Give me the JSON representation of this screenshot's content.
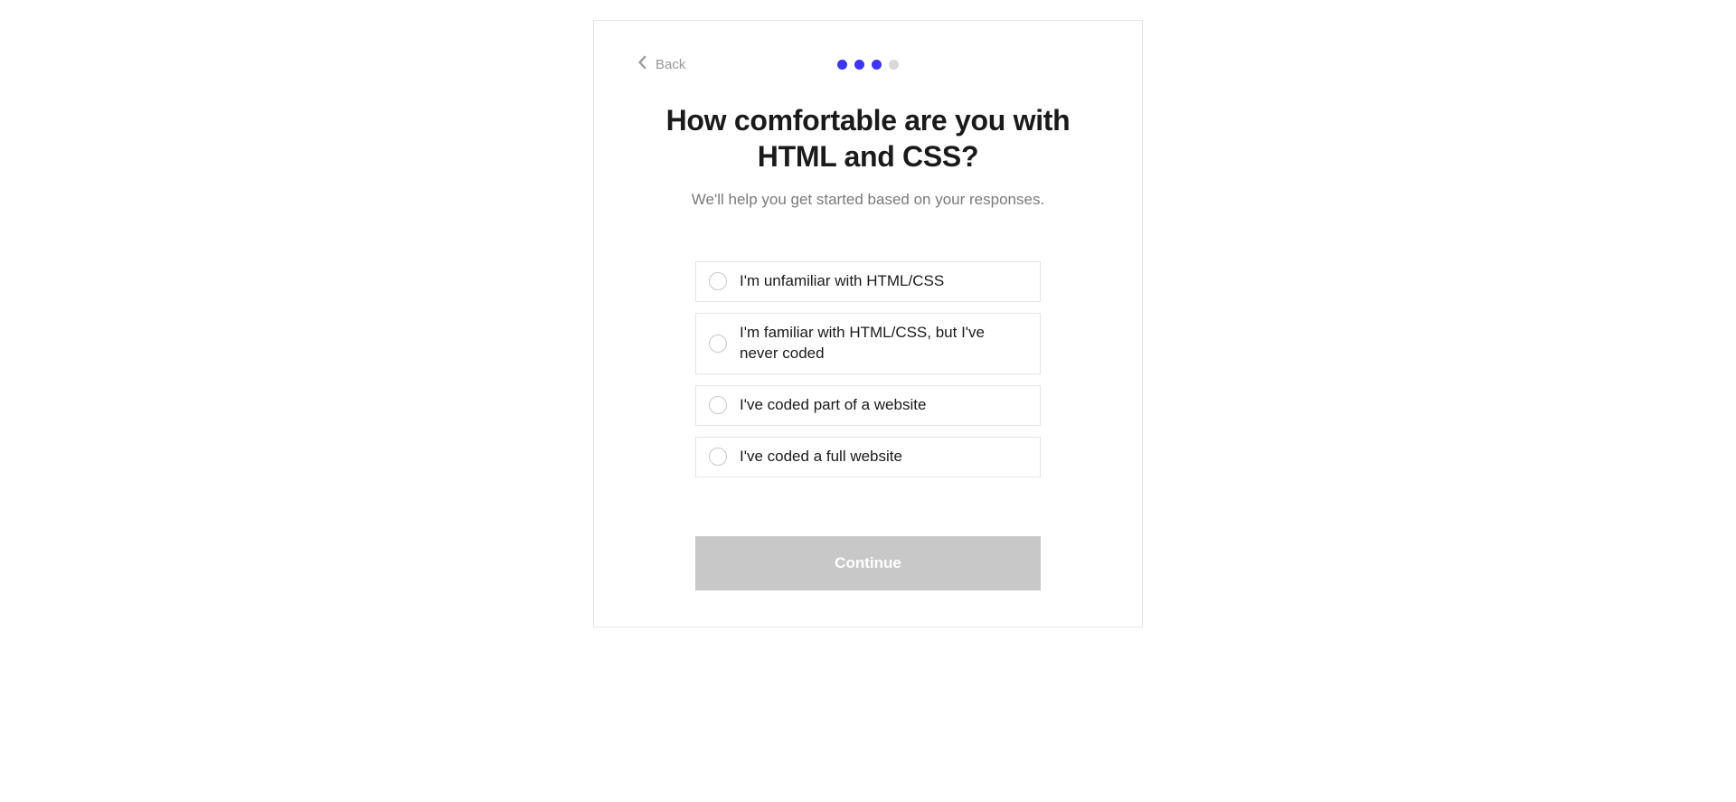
{
  "back": {
    "label": "Back"
  },
  "progress": {
    "total": 4,
    "current": 3
  },
  "heading": "How comfortable are you with HTML and CSS?",
  "subheading": "We'll help you get started based on your responses.",
  "options": [
    {
      "label": "I'm unfamiliar with HTML/CSS"
    },
    {
      "label": "I'm familiar with HTML/CSS, but I've never coded"
    },
    {
      "label": "I've coded part of a website"
    },
    {
      "label": "I've coded a full website"
    }
  ],
  "continue_label": "Continue"
}
